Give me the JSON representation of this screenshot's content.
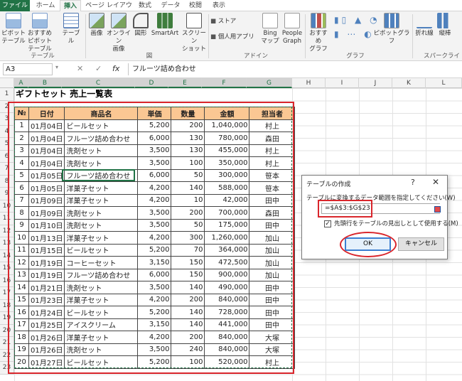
{
  "ribbon_tabs": [
    "ファイル",
    "ホーム",
    "挿入",
    "ページ レイアウト",
    "数式",
    "データ",
    "校閲",
    "表示"
  ],
  "ribbon": {
    "pivot": "ピボット\nテーブル",
    "rec_pivot": "おすすめ\nピボットテーブル",
    "table": "テーブル",
    "image": "画像",
    "online_image": "オンライン\n画像",
    "shapes": "図形",
    "smartart": "SmartArt",
    "screenshot": "スクリーン\nショット",
    "store": "ストア",
    "personal_apps": "個人用アプリ",
    "bing": "Bing\nマップ",
    "people": "People\nGraph",
    "rec_chart": "おすすめ\nグラフ",
    "pivot_chart": "ピボットグラフ",
    "line": "折れ線",
    "column": "縦棒",
    "group_table": "テーブル",
    "group_image": "図",
    "group_addin": "アドイン",
    "group_chart": "グラフ",
    "group_spark": "スパークライン"
  },
  "formula_bar": {
    "name_box": "A3",
    "cancel": "✕",
    "enter": "✓",
    "fx": "fx",
    "value": "フルーツ詰め合わせ"
  },
  "columns": [
    "A",
    "B",
    "C",
    "D",
    "E",
    "F",
    "G",
    "H",
    "I",
    "J",
    "K",
    "L"
  ],
  "rows": [
    "1",
    "2",
    "3",
    "4",
    "5",
    "6",
    "7",
    "8",
    "9",
    "10",
    "11",
    "12",
    "13",
    "14",
    "15",
    "16",
    "17",
    "18",
    "19",
    "20",
    "21",
    "22",
    "23"
  ],
  "sheet_title": "ギフトセット 売上一覧表",
  "table": {
    "headers": [
      "№",
      "日付",
      "商品名",
      "単価",
      "数量",
      "金額",
      "担当者"
    ],
    "rows": [
      [
        "1",
        "01月04日",
        "ビールセット",
        "5,200",
        "200",
        "1,040,000",
        "村上"
      ],
      [
        "2",
        "01月04日",
        "フルーツ詰め合わせ",
        "6,000",
        "130",
        "780,000",
        "森田"
      ],
      [
        "3",
        "01月04日",
        "洗剤セット",
        "3,500",
        "130",
        "455,000",
        "村上"
      ],
      [
        "4",
        "01月04日",
        "洗剤セット",
        "3,500",
        "100",
        "350,000",
        "村上"
      ],
      [
        "5",
        "01月05日",
        "フルーツ詰め合わせ",
        "6,000",
        "50",
        "300,000",
        "笹本"
      ],
      [
        "6",
        "01月05日",
        "洋菓子セット",
        "4,200",
        "140",
        "588,000",
        "笹本"
      ],
      [
        "7",
        "01月09日",
        "洋菓子セット",
        "4,200",
        "10",
        "42,000",
        "田中"
      ],
      [
        "8",
        "01月09日",
        "洗剤セット",
        "3,500",
        "200",
        "700,000",
        "森田"
      ],
      [
        "9",
        "01月10日",
        "洗剤セット",
        "3,500",
        "50",
        "175,000",
        "田中"
      ],
      [
        "10",
        "01月13日",
        "洋菓子セット",
        "4,200",
        "300",
        "1,260,000",
        "加山"
      ],
      [
        "11",
        "01月15日",
        "ビールセット",
        "5,200",
        "70",
        "364,000",
        "加山"
      ],
      [
        "12",
        "01月19日",
        "コーヒーセット",
        "3,150",
        "150",
        "472,500",
        "加山"
      ],
      [
        "13",
        "01月19日",
        "フルーツ詰め合わせ",
        "6,000",
        "150",
        "900,000",
        "加山"
      ],
      [
        "14",
        "01月21日",
        "洗剤セット",
        "3,500",
        "140",
        "490,000",
        "田中"
      ],
      [
        "15",
        "01月23日",
        "洋菓子セット",
        "4,200",
        "200",
        "840,000",
        "田中"
      ],
      [
        "16",
        "01月24日",
        "ビールセット",
        "5,200",
        "140",
        "728,000",
        "田中"
      ],
      [
        "17",
        "01月25日",
        "アイスクリーム",
        "3,150",
        "140",
        "441,000",
        "田中"
      ],
      [
        "18",
        "01月26日",
        "洋菓子セット",
        "4,200",
        "200",
        "840,000",
        "大塚"
      ],
      [
        "19",
        "01月26日",
        "洗剤セット",
        "3,500",
        "240",
        "840,000",
        "大塚"
      ],
      [
        "20",
        "01月27日",
        "ビールセット",
        "5,200",
        "100",
        "520,000",
        "村上"
      ]
    ]
  },
  "dialog": {
    "title": "テーブルの作成",
    "help": "?",
    "close": "✕",
    "prompt": "テーブルに変換するデータ範囲を指定してください(W)",
    "range": "=$A$3:$G$23",
    "checkbox_checked": true,
    "checkbox_mark": "✓",
    "checkbox_label": "先頭行をテーブルの見出しとして使用する(M)",
    "ok": "OK",
    "cancel": "キャンセル"
  },
  "colors": {
    "excel_green": "#217346",
    "header_fill": "#fbc793",
    "annotation_red": "#d9262c"
  }
}
